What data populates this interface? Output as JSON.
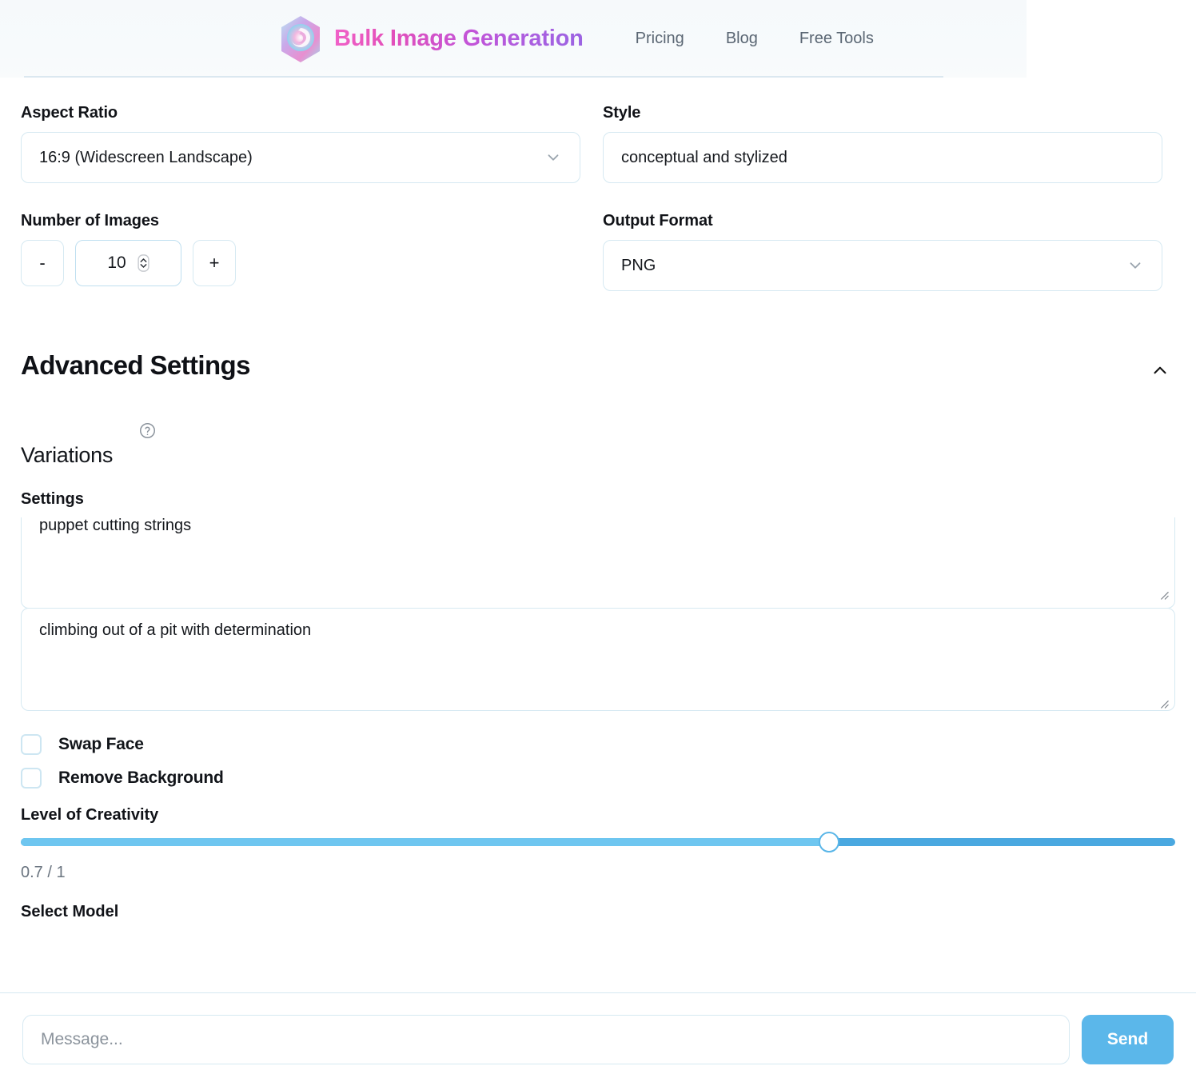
{
  "header": {
    "brand_title": "Bulk Image Generation",
    "logo_icon": "swirl-gem-logo",
    "nav": [
      {
        "label": "Pricing"
      },
      {
        "label": "Blog"
      },
      {
        "label": "Free Tools"
      }
    ]
  },
  "form": {
    "aspect_ratio": {
      "label": "Aspect Ratio",
      "value": "16:9 (Widescreen Landscape)",
      "icon": "chevron-down-icon"
    },
    "style": {
      "label": "Style",
      "value": "conceptual and stylized"
    },
    "number_of_images": {
      "label": "Number of Images",
      "decrement_label": "-",
      "increment_label": "+",
      "value": "10",
      "spinner_icon": "spinner-updown-icon"
    },
    "output_format": {
      "label": "Output Format",
      "value": "PNG",
      "icon": "chevron-down-icon"
    }
  },
  "advanced": {
    "title": "Advanced Settings",
    "toggle_icon": "chevron-up-icon",
    "variations": {
      "title": "Variations",
      "help_icon": "help-circle-icon"
    },
    "settings": {
      "label": "Settings",
      "variation_1": "puppet cutting strings",
      "variation_2": "climbing out of a pit with determination",
      "resize_icon": "resize-grip-icon"
    },
    "checkboxes": [
      {
        "label": "Swap Face",
        "checked": false
      },
      {
        "label": "Remove Background",
        "checked": false
      }
    ],
    "creativity": {
      "label": "Level of Creativity",
      "value_text": "0.7 / 1",
      "value": 0.7,
      "min": 0,
      "max": 1,
      "fill_color": "#6ec6f0",
      "track_color": "#4aa8e0"
    },
    "select_model": {
      "label": "Select Model"
    }
  },
  "message_bar": {
    "placeholder": "Message...",
    "input_value": "",
    "send_label": "Send",
    "send_color": "#5bb7ea"
  }
}
